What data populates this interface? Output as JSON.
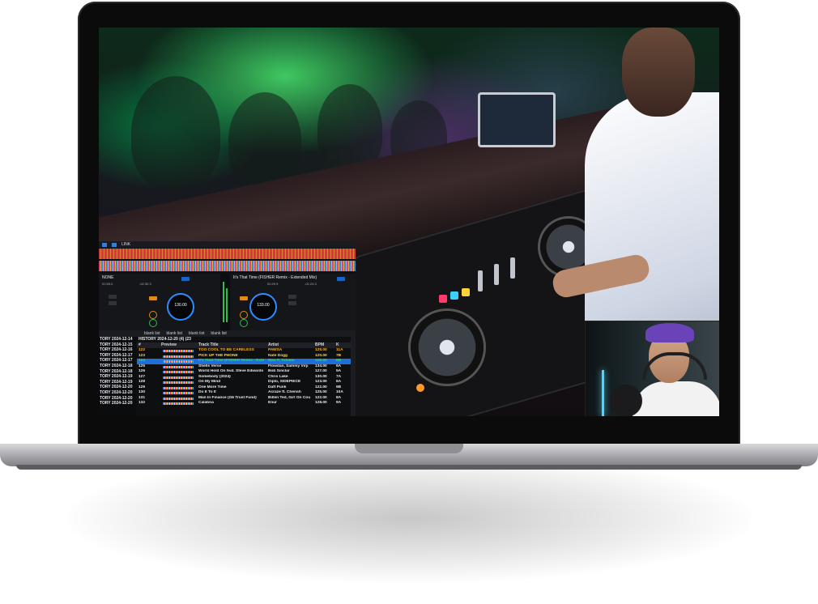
{
  "rekordbox": {
    "top_label": "LINK",
    "deck_left": {
      "track": "NONE",
      "bpm": "130.00",
      "time_elapsed": "01:59.0",
      "time_remaining": "-02:30.3"
    },
    "deck_right": {
      "track": "It's That Time (FISHER Remix - Extended Mix)",
      "bpm": "133.00",
      "time_elapsed": "02:29.9",
      "time_remaining": "-01:23.3"
    },
    "tabs": [
      "blank list",
      "blank list",
      "blank list",
      "blank list"
    ],
    "history_title": "HISTORY 2024-12-20 (4) (23",
    "sidebar": [
      "TORY 2024-12-14",
      "TORY 2024-12-15",
      "TORY 2024-12-16",
      "TORY 2024-12-17",
      "TORY 2024-12-17",
      "TORY 2024-12-18",
      "TORY 2024-12-18",
      "TORY 2024-12-19",
      "TORY 2024-12-19",
      "TORY 2024-12-20",
      "TORY 2024-12-20",
      "TORY 2024-12-20",
      "TORY 2024-12-20"
    ],
    "columns": {
      "num": "#",
      "preview": "Preview",
      "title": "Track Title",
      "artist": "Artist",
      "bpm": "BPM",
      "key": "K"
    },
    "rows": [
      {
        "num": "122",
        "title": "TOO COOL TO BE CARELESS",
        "artist": "PAWSA",
        "bpm": "125.00",
        "key": "11A",
        "color": "#ffb21f"
      },
      {
        "num": "123",
        "title": "PICK UP THE PHONE",
        "artist": "Nate Dogg",
        "bpm": "120.00",
        "key": "7B",
        "color": "#ffd34d"
      },
      {
        "num": "124",
        "title": "It's That Time (FISHER Remix - Exte",
        "artist": "Mau P, Tchami",
        "bpm": "126.00",
        "key": "8B",
        "color": "#22e06a"
      },
      {
        "num": "125",
        "title": "Shells Verse",
        "artist": "Flowdan, Sammy Virji",
        "bpm": "134.00",
        "key": "6A",
        "color": "#e9ecf1"
      },
      {
        "num": "126",
        "title": "World Hold On feat. Steve Edwards",
        "artist": "Bob Sinclar",
        "bpm": "127.00",
        "key": "5A",
        "color": "#e9ecf1"
      },
      {
        "num": "127",
        "title": "Somebody (2024)",
        "artist": "Chris Lake",
        "bpm": "130.00",
        "key": "7A",
        "color": "#e9ecf1"
      },
      {
        "num": "128",
        "title": "On My Mind",
        "artist": "Diplo, SIDEPIECE",
        "bpm": "123.00",
        "key": "6A",
        "color": "#e9ecf1"
      },
      {
        "num": "129",
        "title": "One More Time",
        "artist": "Daft Punk",
        "bpm": "122.00",
        "key": "9B",
        "color": "#e9ecf1"
      },
      {
        "num": "130",
        "title": "Do It To It",
        "artist": "Acraze ft. Cherish",
        "bpm": "125.00",
        "key": "10A",
        "color": "#e9ecf1"
      },
      {
        "num": "131",
        "title": "Man In Finance (G6 Trust Fund)",
        "artist": "Billen Ted, Girl On Cou",
        "bpm": "122.00",
        "key": "8A",
        "color": "#e9ecf1"
      },
      {
        "num": "132",
        "title": "Calabria",
        "artist": "Enur",
        "bpm": "128.00",
        "key": "9A",
        "color": "#e9ecf1"
      }
    ]
  },
  "colors": {
    "accent_blue": "#1f6fd8",
    "playing_green": "#22e06a",
    "warning_orange": "#ffb21f"
  }
}
